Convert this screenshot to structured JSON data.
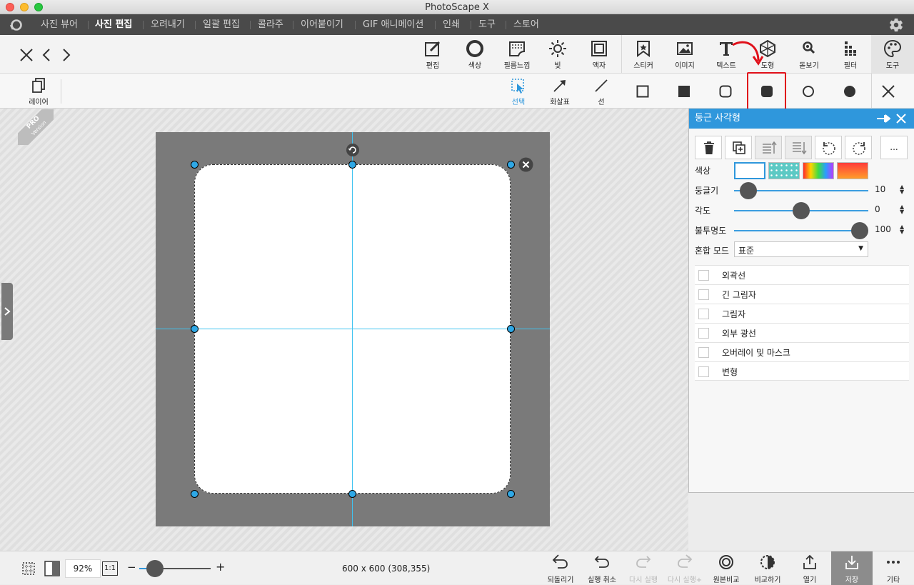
{
  "window": {
    "title": "PhotoScape X"
  },
  "menu": {
    "items": [
      "사진 뷰어",
      "사진 편집",
      "오려내기",
      "일괄 편집",
      "콜라주",
      "이어붙이기",
      "GIF 애니메이션",
      "인쇄",
      "도구",
      "스토어"
    ],
    "active": "사진 편집"
  },
  "toolbar": {
    "tools": [
      "편집",
      "색상",
      "필름느낌",
      "빛",
      "액자",
      "스티커",
      "이미지",
      "텍스트",
      "도형",
      "돋보기",
      "필터",
      "도구"
    ]
  },
  "subtoolbar": {
    "layer_label": "레이어",
    "select_label": "선택",
    "arrow_label": "화살표",
    "line_label": "선"
  },
  "panel": {
    "title": "둥근 사각형",
    "color_label": "색상",
    "roundness": {
      "label": "둥글기",
      "value": "10",
      "fraction": 0.05
    },
    "angle": {
      "label": "각도",
      "value": "0",
      "fraction": 0.5
    },
    "opacity": {
      "label": "불투명도",
      "value": "100",
      "fraction": 1.0
    },
    "blend": {
      "label": "혼합 모드",
      "value": "표준"
    },
    "more_label": "...",
    "options": [
      "외곽선",
      "긴 그림자",
      "그림자",
      "외부 광선",
      "오버레이 및 마스크",
      "변형"
    ]
  },
  "watermark": {
    "pro": "PRO",
    "version": "Version"
  },
  "status": {
    "zoom": "92%",
    "one_to_one": "1:1",
    "minus": "−",
    "plus": "+",
    "dimensions": "600 x 600 (308,355)"
  },
  "bottom": {
    "tools": [
      "되돌리기",
      "실행 취소",
      "다시 실행",
      "다시 실행+",
      "원본비교",
      "비교하기",
      "열기",
      "저장",
      "기타"
    ]
  },
  "colors": {
    "accent": "#2f97dc",
    "highlight": "#e0101a",
    "menubar": "#4a4a4a"
  }
}
